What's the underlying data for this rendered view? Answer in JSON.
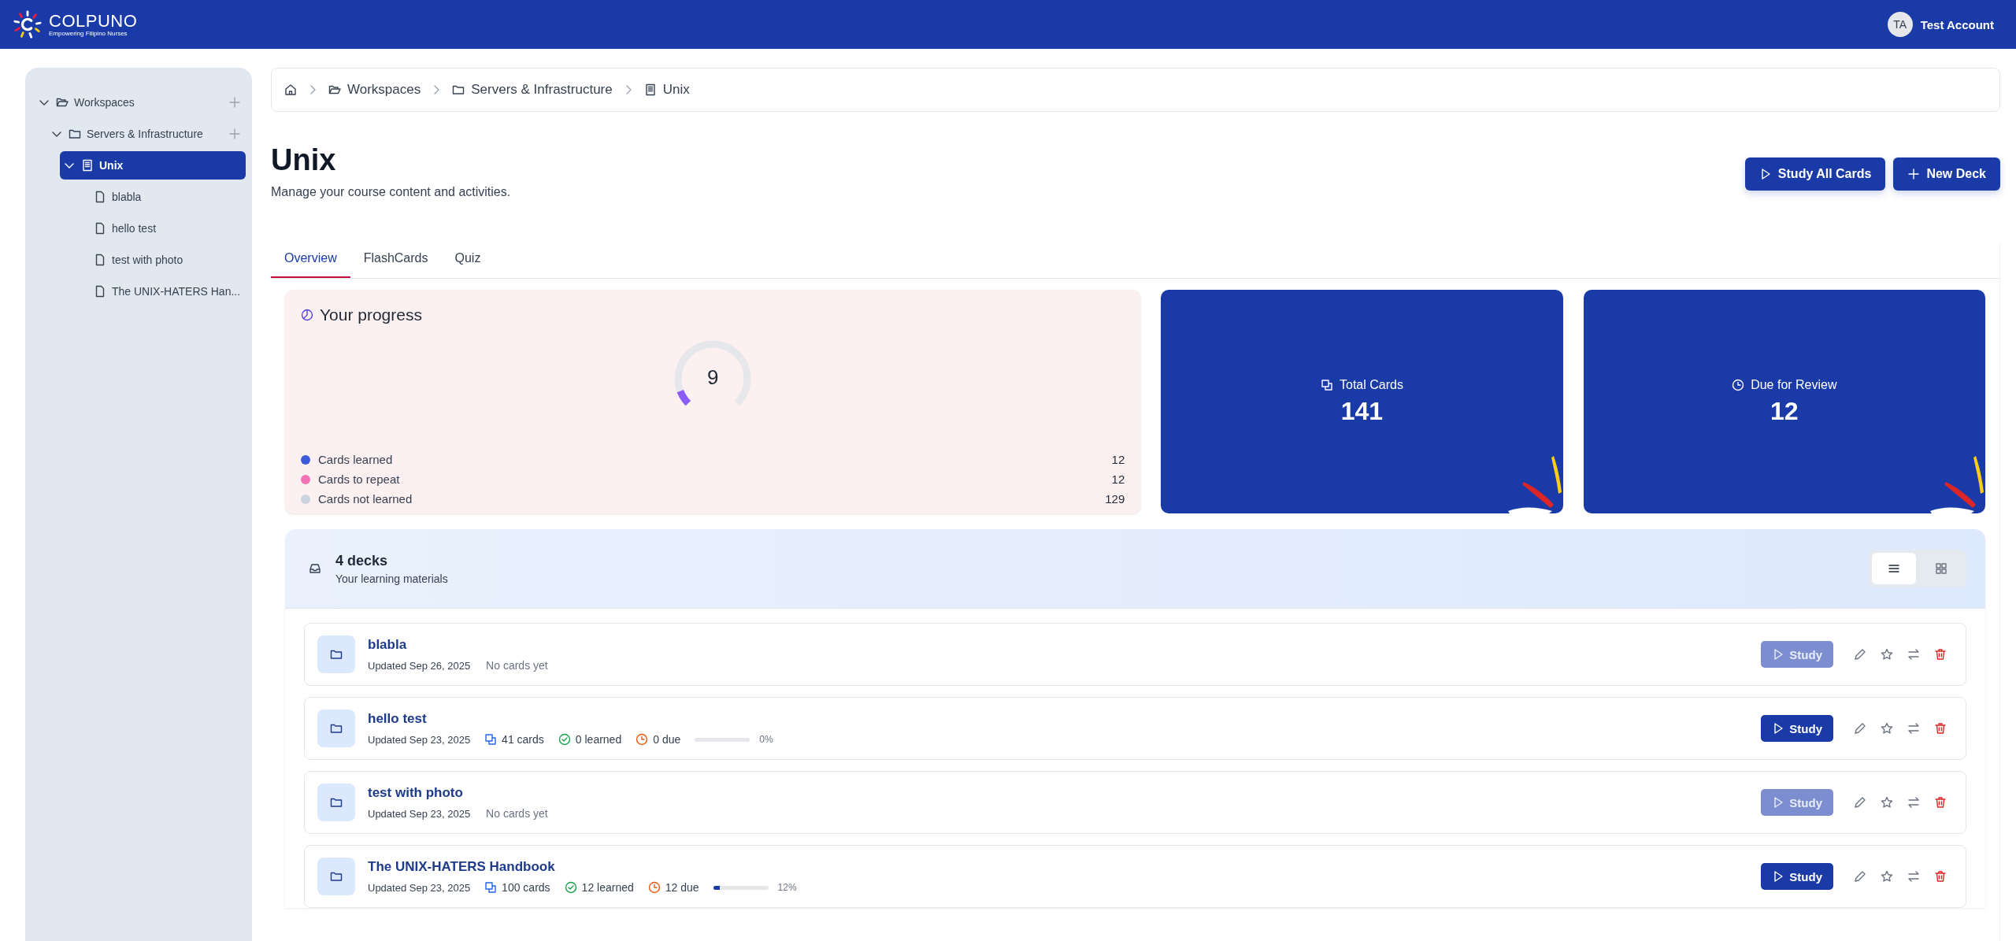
{
  "brand": {
    "name": "COLPUNO",
    "tagline": "Empowering Filipino Nurses"
  },
  "account": {
    "initials": "TA",
    "name": "Test Account"
  },
  "sidebar": {
    "tree": [
      {
        "label": "Workspaces",
        "kind": "workspace",
        "expanded": true,
        "addable": true,
        "selected": false,
        "children": [
          {
            "label": "Servers & Infrastructure",
            "kind": "folder",
            "expanded": true,
            "addable": true,
            "selected": false,
            "children": [
              {
                "label": "Unix",
                "kind": "course",
                "expanded": true,
                "selected": true,
                "children": [
                  {
                    "label": "blabla",
                    "kind": "deck",
                    "selected": false
                  },
                  {
                    "label": "hello test",
                    "kind": "deck",
                    "selected": false
                  },
                  {
                    "label": "test with photo",
                    "kind": "deck",
                    "selected": false
                  },
                  {
                    "label": "The UNIX-HATERS Han...",
                    "kind": "deck",
                    "selected": false
                  }
                ]
              }
            ]
          }
        ]
      }
    ]
  },
  "breadcrumb": [
    {
      "label": "Workspaces",
      "kind": "workspace"
    },
    {
      "label": "Servers & Infrastructure",
      "kind": "folder"
    },
    {
      "label": "Unix",
      "kind": "course"
    }
  ],
  "page": {
    "title": "Unix",
    "subtitle": "Manage your course content and activities.",
    "actions": [
      {
        "label": "Study All Cards",
        "kind": "study"
      },
      {
        "label": "New Deck",
        "kind": "add"
      }
    ]
  },
  "tabs": [
    {
      "label": "Overview",
      "selected": true
    },
    {
      "label": "FlashCards",
      "selected": false
    },
    {
      "label": "Quiz",
      "selected": false
    }
  ],
  "progress": {
    "title": "Your progress",
    "value": "9",
    "level": 0.09,
    "legend": [
      {
        "label": "Cards learned",
        "count": "12",
        "color": "#3b5bdb"
      },
      {
        "label": "Cards to repeat",
        "count": "12",
        "color": "#f472b6"
      },
      {
        "label": "Cards not learned",
        "count": "129",
        "color": "#cbd5e1"
      }
    ]
  },
  "stats": [
    {
      "label": "Total Cards",
      "value": "141",
      "kind": "cards"
    },
    {
      "label": "Due for Review",
      "value": "12",
      "kind": "due"
    }
  ],
  "decks": {
    "title": "4 decks",
    "subtitle": "Your learning materials",
    "views": [
      {
        "kind": "list",
        "selected": true
      },
      {
        "kind": "grid",
        "selected": false
      }
    ],
    "items": [
      {
        "name": "blabla",
        "updated": "Updated Sep 26, 2025",
        "kind": "empty",
        "note": "No cards yet",
        "study": "Study",
        "disabled": true
      },
      {
        "name": "hello test",
        "updated": "Updated Sep 23, 2025",
        "kind": "stats",
        "cards": "41 cards",
        "learned": "0 learned",
        "due": "0 due",
        "level": 0,
        "percent": "0%",
        "study": "Study",
        "disabled": false
      },
      {
        "name": "test with photo",
        "updated": "Updated Sep 23, 2025",
        "kind": "empty",
        "note": "No cards yet",
        "study": "Study",
        "disabled": true
      },
      {
        "name": "The UNIX-HATERS Handbook",
        "updated": "Updated Sep 23, 2025",
        "kind": "stats",
        "cards": "100 cards",
        "learned": "12 learned",
        "due": "12 due",
        "level": 0.12,
        "percent": "12%",
        "study": "Study",
        "disabled": false
      }
    ]
  }
}
